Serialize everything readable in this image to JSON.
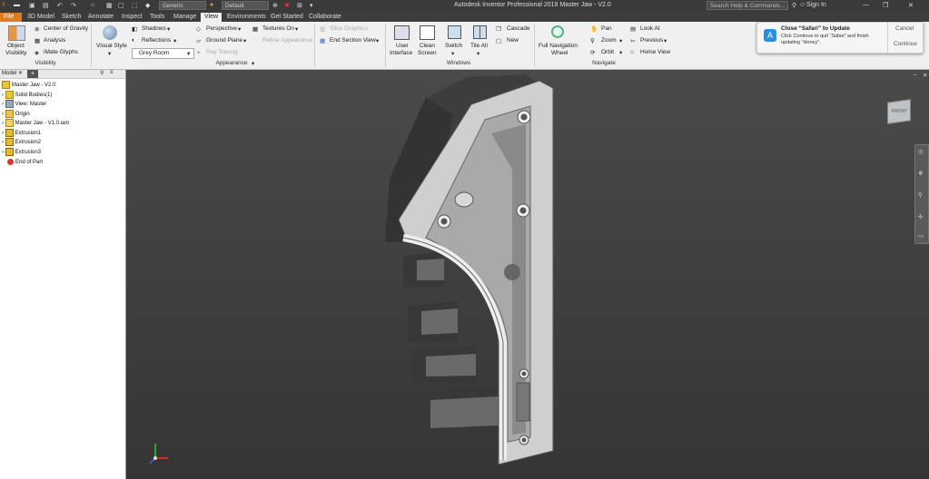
{
  "titlebar": {
    "appearance_combo": "Generic",
    "material_combo": "Default",
    "window_title": "Autodesk Inventor Professional 2019    Master Jaw - V2.0",
    "search_placeholder": "Search Help & Commands...",
    "sign_in": "Sign In"
  },
  "menus": [
    "File",
    "3D Model",
    "Sketch",
    "Annotate",
    "Inspect",
    "Tools",
    "Manage",
    "View",
    "Environments",
    "Get Started",
    "Collaborate"
  ],
  "ribbon": {
    "visibility": {
      "object_visibility_1": "Object",
      "object_visibility_2": "Visibility",
      "center_of_gravity": "Center of Gravity",
      "analysis": "Analysis",
      "imate_glyphs": "iMate Glyphs",
      "group": "Visibility"
    },
    "appearance": {
      "visual_style": "Visual Style",
      "shadows": "Shadows",
      "reflections": "Reflections",
      "grey_room": "Grey Room",
      "perspective": "Perspective",
      "ground_plane": "Ground Plane",
      "ray_tracing": "Ray Tracing",
      "textures_on": "Textures On",
      "refine_appearance": "Refine Appearance",
      "group": "Appearance"
    },
    "sections": {
      "slice_graphics": "Slice Graphics",
      "end_section_view": "End Section View"
    },
    "windows": {
      "user_interface_1": "User",
      "user_interface_2": "Interface",
      "clean_screen_1": "Clean",
      "clean_screen_2": "Screen",
      "switch": "Switch",
      "tile_all": "Tile All",
      "cascade": "Cascade",
      "new": "New",
      "group": "Windows"
    },
    "navigate": {
      "full_nav_1": "Full Navigation",
      "full_nav_2": "Wheel",
      "pan": "Pan",
      "zoom": "Zoom",
      "orbit": "Orbit",
      "look_at": "Look At",
      "previous": "Previous",
      "home_view": "Home View",
      "group": "Navigate"
    }
  },
  "notification": {
    "title": "Close “Safari” to Update",
    "body_1": "Click Continue to quit “Safari” and finish",
    "body_2": "updating “Honey”.",
    "cancel": "Cancel",
    "continue": "Continue"
  },
  "browser": {
    "tab": "Model",
    "add": "+",
    "items": [
      "Master Jaw - V2.0",
      "Solid Bodies(1)",
      "View: Master",
      "Origin",
      "Master Jaw - V1.0.iam",
      "Extrusion1",
      "Extrusion2",
      "Extrusion3",
      "End of Part"
    ]
  },
  "viewcube": {
    "face": "FRONT"
  },
  "colors": {
    "file_tab": "#e07b1f",
    "ribbon": "#f0f0f0",
    "viewport_top": "#4a4a4a",
    "viewport_bottom": "#353535"
  }
}
